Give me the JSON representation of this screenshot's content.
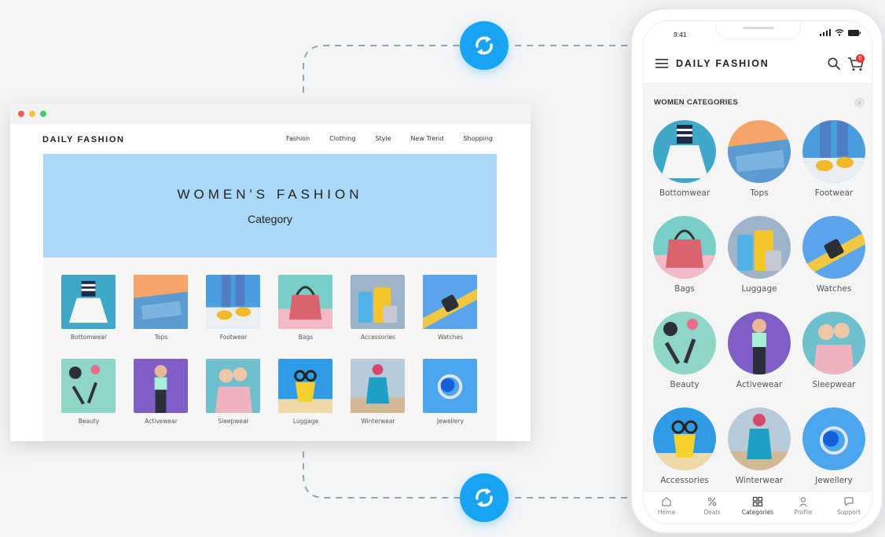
{
  "colors": {
    "accent": "#19a4f3",
    "hero": "#abd8f6",
    "badge": "#e53935"
  },
  "desktop": {
    "brand": "DAILY FASHION",
    "nav": [
      "Fashion",
      "Clothing",
      "Style",
      "New Trend",
      "Shopping"
    ],
    "hero_title": "WOMEN'S FASHION",
    "hero_subtitle": "Category",
    "categories": [
      "Bottomwear",
      "Tops",
      "Footwear",
      "Bags",
      "Accessories",
      "Watches",
      "Beauty",
      "Activewear",
      "Sleepwear",
      "Luggage",
      "Winterwear",
      "Jewellery"
    ]
  },
  "mobile": {
    "time": "9:41",
    "brand": "DAILY FASHION",
    "cart_count": "0",
    "section_title": "WOMEN CATEGORIES",
    "categories": [
      "Bottomwear",
      "Tops",
      "Footwear",
      "Bags",
      "Luggage",
      "Watches",
      "Beauty",
      "Activewear",
      "Sleepwear",
      "Accessories",
      "Winterwear",
      "Jewellery"
    ],
    "tabs": [
      {
        "label": "Home",
        "icon": "home-icon"
      },
      {
        "label": "Deals",
        "icon": "percent-icon"
      },
      {
        "label": "Categories",
        "icon": "grid-icon",
        "active": true
      },
      {
        "label": "Profile",
        "icon": "user-icon"
      },
      {
        "label": "Support",
        "icon": "chat-icon"
      }
    ]
  },
  "icons": {
    "sync": "sync-icon",
    "cart": "cart-icon",
    "search": "search-icon",
    "menu": "menu-icon"
  }
}
